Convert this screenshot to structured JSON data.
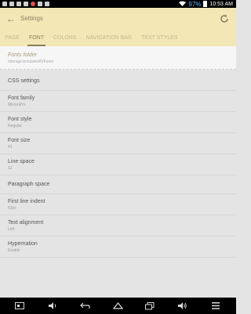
{
  "status_bar": {
    "battery": "97%",
    "time": "10:53 AM"
  },
  "app": {
    "title": "Settings"
  },
  "tabs": [
    {
      "label": "PAGE"
    },
    {
      "label": "FONT"
    },
    {
      "label": "COLORS"
    },
    {
      "label": "NAVIGATION BAR"
    },
    {
      "label": "TEXT STYLES"
    }
  ],
  "active_tab": "FONT",
  "fonts_folder": {
    "title": "Fonts folder",
    "path": "/storage/emulated/0/Fonts"
  },
  "settings": [
    {
      "label": "CSS settings"
    },
    {
      "label": "Font family",
      "value": "MinionPro"
    },
    {
      "label": "Font style",
      "value": "Regular"
    },
    {
      "label": "Font size",
      "value": "41"
    },
    {
      "label": "Line space",
      "value": "12"
    },
    {
      "label": "Paragraph space"
    },
    {
      "label": "First line indent",
      "value": "62px"
    },
    {
      "label": "Text alignment",
      "value": "Left"
    },
    {
      "label": "Hypernation",
      "value": "Enable"
    }
  ],
  "icons": [
    "back-icon",
    "refresh-icon",
    "wifi-icon",
    "battery-icon",
    "screenshot-icon",
    "volume-down-icon",
    "nav-back-icon",
    "home-icon",
    "recents-icon",
    "volume-up-icon",
    "menu-icon"
  ]
}
